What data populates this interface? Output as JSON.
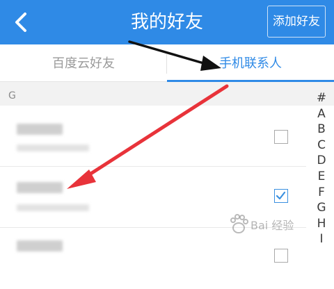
{
  "header": {
    "back_icon": "chevron-left-icon",
    "title": "我的好友",
    "add_button_label": "添加好友"
  },
  "tabs": [
    {
      "label": "百度云好友",
      "active": false
    },
    {
      "label": "手机联系人",
      "active": true
    }
  ],
  "section": {
    "letter": "G"
  },
  "contacts": [
    {
      "name": "",
      "detail": "",
      "checked": false
    },
    {
      "name": "",
      "detail": "",
      "checked": true
    },
    {
      "name": "",
      "detail": "",
      "checked": false
    }
  ],
  "index_bar": [
    "#",
    "A",
    "B",
    "C",
    "D",
    "E",
    "F",
    "G",
    "H",
    "I"
  ],
  "watermark": {
    "text": "Bai 经验",
    "icon": "baidu-paw-logo"
  },
  "colors": {
    "header_bg": "#2f8ae6",
    "active_tab": "#2f8ae6",
    "arrow_black": "#111111",
    "arrow_red": "#e8333a"
  }
}
